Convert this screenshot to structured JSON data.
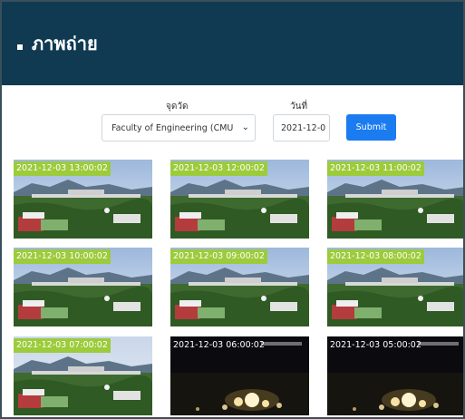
{
  "header": {
    "title": "ภาพถ่าย"
  },
  "filters": {
    "location_label": "จุดวัด",
    "location_value": "Faculty of Engineering (CMU",
    "date_label": "วันที่",
    "date_value": "2021-12-0",
    "submit_label": "Submit"
  },
  "photos": [
    {
      "timestamp": "2021-12-03 13:00:02",
      "scene": "day"
    },
    {
      "timestamp": "2021-12-03 12:00:02",
      "scene": "day"
    },
    {
      "timestamp": "2021-12-03 11:00:02",
      "scene": "day"
    },
    {
      "timestamp": "2021-12-03 10:00:02",
      "scene": "day"
    },
    {
      "timestamp": "2021-12-03 09:00:02",
      "scene": "day"
    },
    {
      "timestamp": "2021-12-03 08:00:02",
      "scene": "day"
    },
    {
      "timestamp": "2021-12-03 07:00:02",
      "scene": "dawn"
    },
    {
      "timestamp": "2021-12-03 06:00:02",
      "scene": "night"
    },
    {
      "timestamp": "2021-12-03 05:00:02",
      "scene": "night"
    }
  ],
  "colors": {
    "header_bg": "#0f3a52",
    "submit_bg": "#1a7cf0",
    "stamp_bg": "#9ccb3b"
  }
}
